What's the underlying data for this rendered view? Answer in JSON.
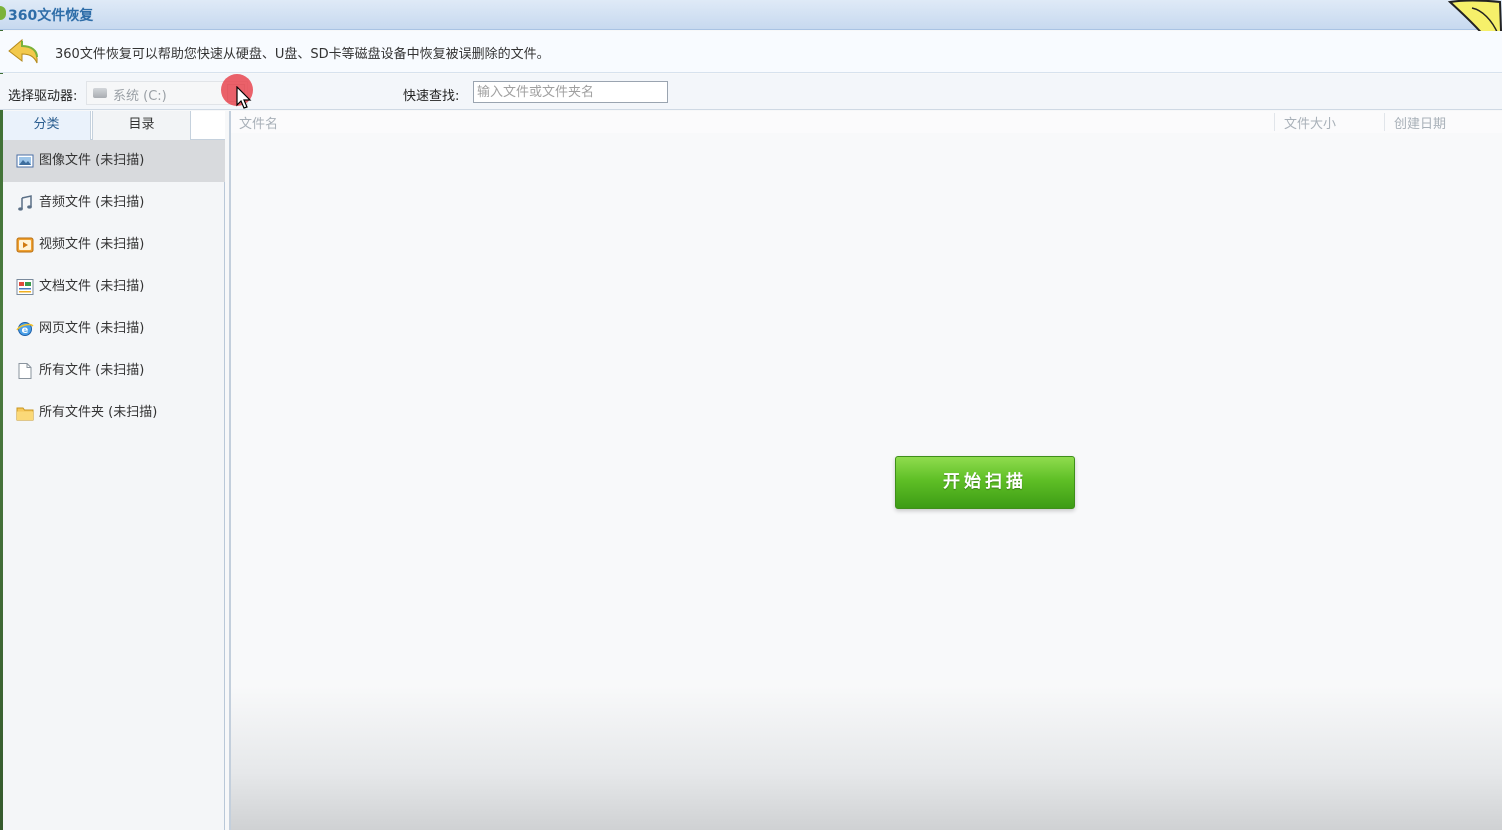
{
  "window": {
    "title": "360文件恢复"
  },
  "info": {
    "description": "360文件恢复可以帮助您快速从硬盘、U盘、SD卡等磁盘设备中恢复被误删除的文件。"
  },
  "toolbar": {
    "drive_label": "选择驱动器:",
    "drive_value": "系统 (C:)",
    "search_label": "快速查找:",
    "search_placeholder": "输入文件或文件夹名",
    "search_value": ""
  },
  "sidebar": {
    "tabs": [
      {
        "label": "分类",
        "active": true
      },
      {
        "label": "目录",
        "active": false
      }
    ],
    "items": [
      {
        "label": "图像文件 (未扫描)",
        "icon": "image-icon",
        "active": true
      },
      {
        "label": "音频文件 (未扫描)",
        "icon": "music-note-icon",
        "active": false
      },
      {
        "label": "视频文件 (未扫描)",
        "icon": "video-icon",
        "active": false
      },
      {
        "label": "文档文件 (未扫描)",
        "icon": "document-icon",
        "active": false
      },
      {
        "label": "网页文件 (未扫描)",
        "icon": "ie-globe-icon",
        "active": false
      },
      {
        "label": "所有文件 (未扫描)",
        "icon": "blank-file-icon",
        "active": false
      },
      {
        "label": "所有文件夹 (未扫描)",
        "icon": "folder-icon",
        "active": false
      }
    ]
  },
  "table": {
    "columns": [
      "文件名",
      "文件大小",
      "创建日期"
    ]
  },
  "scan_button": {
    "label": "开始扫描"
  },
  "colors": {
    "scan_button": "#5fbf26",
    "title_text": "#2e6da8",
    "active_item": "#d8dadd",
    "click_indicator": "#e84650"
  }
}
